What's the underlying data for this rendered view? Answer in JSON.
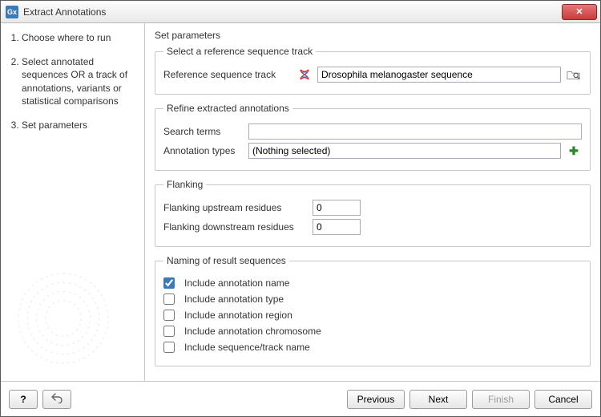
{
  "window": {
    "app_icon_text": "Gx",
    "title": "Extract Annotations",
    "close_glyph": "✕"
  },
  "sidebar": {
    "steps": [
      "Choose where to run",
      "Select annotated sequences OR a track of annotations, variants or statistical comparisons",
      "Set parameters"
    ]
  },
  "main": {
    "title": "Set parameters",
    "section_reference": {
      "legend": "Select a reference sequence track",
      "label": "Reference sequence track",
      "value": "Drosophila melanogaster sequence"
    },
    "section_refine": {
      "legend": "Refine extracted annotations",
      "search_label": "Search terms",
      "search_value": "",
      "types_label": "Annotation types",
      "types_value": "(Nothing selected)"
    },
    "section_flanking": {
      "legend": "Flanking",
      "upstream_label": "Flanking upstream residues",
      "upstream_value": "0",
      "downstream_label": "Flanking downstream residues",
      "downstream_value": "0"
    },
    "section_naming": {
      "legend": "Naming of result sequences",
      "options": [
        {
          "label": "Include annotation name",
          "checked": true
        },
        {
          "label": "Include annotation type",
          "checked": false
        },
        {
          "label": "Include annotation region",
          "checked": false
        },
        {
          "label": "Include annotation chromosome",
          "checked": false
        },
        {
          "label": "Include sequence/track name",
          "checked": false
        }
      ]
    }
  },
  "footer": {
    "help": "?",
    "reset_glyph": "↺",
    "previous": "Previous",
    "next": "Next",
    "finish": "Finish",
    "cancel": "Cancel"
  }
}
